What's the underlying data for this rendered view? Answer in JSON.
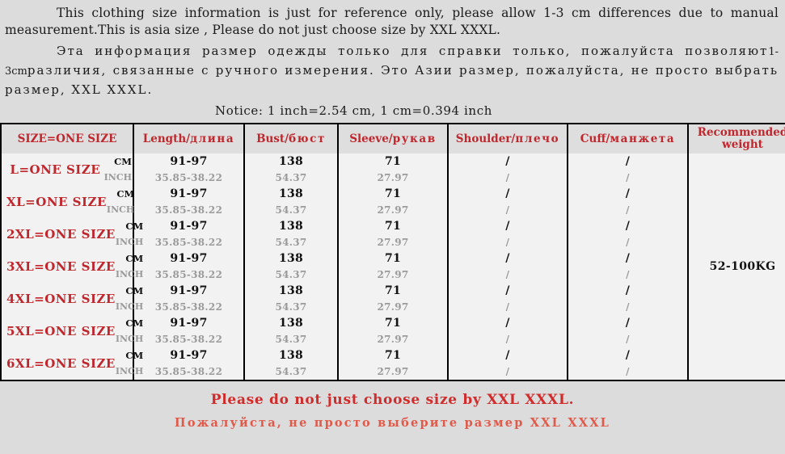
{
  "intro": {
    "en": "This clothing size information is just for reference only, please allow 1-3 cm differences due to manual measurement.This is asia size , Please do not just choose size by XXL XXXL.",
    "ru_line1": "Эта информация размер одежды только для справки только, пожалуйста позволяют",
    "ru_small": "1-3cm",
    "ru_line2": "различия, связанные с ручного измерения. Это Азии размер, пожалуйста, не просто выбрать размер, XXL XXXL."
  },
  "notice": "Notice: 1 inch=2.54 cm, 1 cm=0.394 inch",
  "table": {
    "headers": {
      "size": "SIZE=ONE SIZE",
      "length_en": "Length/",
      "length_ru": "длина",
      "bust_en": "Bust/",
      "bust_ru": "бюст",
      "sleeve_en": "Sleeve/",
      "sleeve_ru": "рукав",
      "shoulder_en": "Shoulder/",
      "shoulder_ru": "плечо",
      "cuff_en": "Cuff/",
      "cuff_ru": "манжета",
      "weight_line1": "Recommended",
      "weight_line2": "weight"
    },
    "units": {
      "cm": "CM",
      "inch": "INCH"
    },
    "recommended_weight": "52-100KG",
    "rows": [
      {
        "size": "L=ONE SIZE",
        "length_cm": "91-97",
        "length_in": "35.85-38.22",
        "bust_cm": "138",
        "bust_in": "54.37",
        "sleeve_cm": "71",
        "sleeve_in": "27.97",
        "shoulder_cm": "/",
        "shoulder_in": "/",
        "cuff_cm": "/",
        "cuff_in": "/"
      },
      {
        "size": "XL=ONE SIZE",
        "length_cm": "91-97",
        "length_in": "35.85-38.22",
        "bust_cm": "138",
        "bust_in": "54.37",
        "sleeve_cm": "71",
        "sleeve_in": "27.97",
        "shoulder_cm": "/",
        "shoulder_in": "/",
        "cuff_cm": "/",
        "cuff_in": "/"
      },
      {
        "size": "2XL=ONE SIZE",
        "length_cm": "91-97",
        "length_in": "35.85-38.22",
        "bust_cm": "138",
        "bust_in": "54.37",
        "sleeve_cm": "71",
        "sleeve_in": "27.97",
        "shoulder_cm": "/",
        "shoulder_in": "/",
        "cuff_cm": "/",
        "cuff_in": "/"
      },
      {
        "size": "3XL=ONE SIZE",
        "length_cm": "91-97",
        "length_in": "35.85-38.22",
        "bust_cm": "138",
        "bust_in": "54.37",
        "sleeve_cm": "71",
        "sleeve_in": "27.97",
        "shoulder_cm": "/",
        "shoulder_in": "/",
        "cuff_cm": "/",
        "cuff_in": "/"
      },
      {
        "size": "4XL=ONE SIZE",
        "length_cm": "91-97",
        "length_in": "35.85-38.22",
        "bust_cm": "138",
        "bust_in": "54.37",
        "sleeve_cm": "71",
        "sleeve_in": "27.97",
        "shoulder_cm": "/",
        "shoulder_in": "/",
        "cuff_cm": "/",
        "cuff_in": "/"
      },
      {
        "size": "5XL=ONE SIZE",
        "length_cm": "91-97",
        "length_in": "35.85-38.22",
        "bust_cm": "138",
        "bust_in": "54.37",
        "sleeve_cm": "71",
        "sleeve_in": "27.97",
        "shoulder_cm": "/",
        "shoulder_in": "/",
        "cuff_cm": "/",
        "cuff_in": "/"
      },
      {
        "size": "6XL=ONE SIZE",
        "length_cm": "91-97",
        "length_in": "35.85-38.22",
        "bust_cm": "138",
        "bust_in": "54.37",
        "sleeve_cm": "71",
        "sleeve_in": "27.97",
        "shoulder_cm": "/",
        "shoulder_in": "/",
        "cuff_cm": "/",
        "cuff_in": "/"
      }
    ]
  },
  "footer": {
    "en": "Please do not just choose size by XXL XXXL.",
    "ru": "Пожалуйста, не просто выберите размер XXL XXXL"
  },
  "colors": {
    "page_background": "#dcdcdc",
    "cell_background": "#f2f2f2",
    "header_background": "#dedede",
    "header_red": "#c0272d",
    "footer_red": "#d12c2c",
    "footer_ru_red": "#e05a4a",
    "inch_gray": "#9a9a9a",
    "border": "#000000"
  }
}
